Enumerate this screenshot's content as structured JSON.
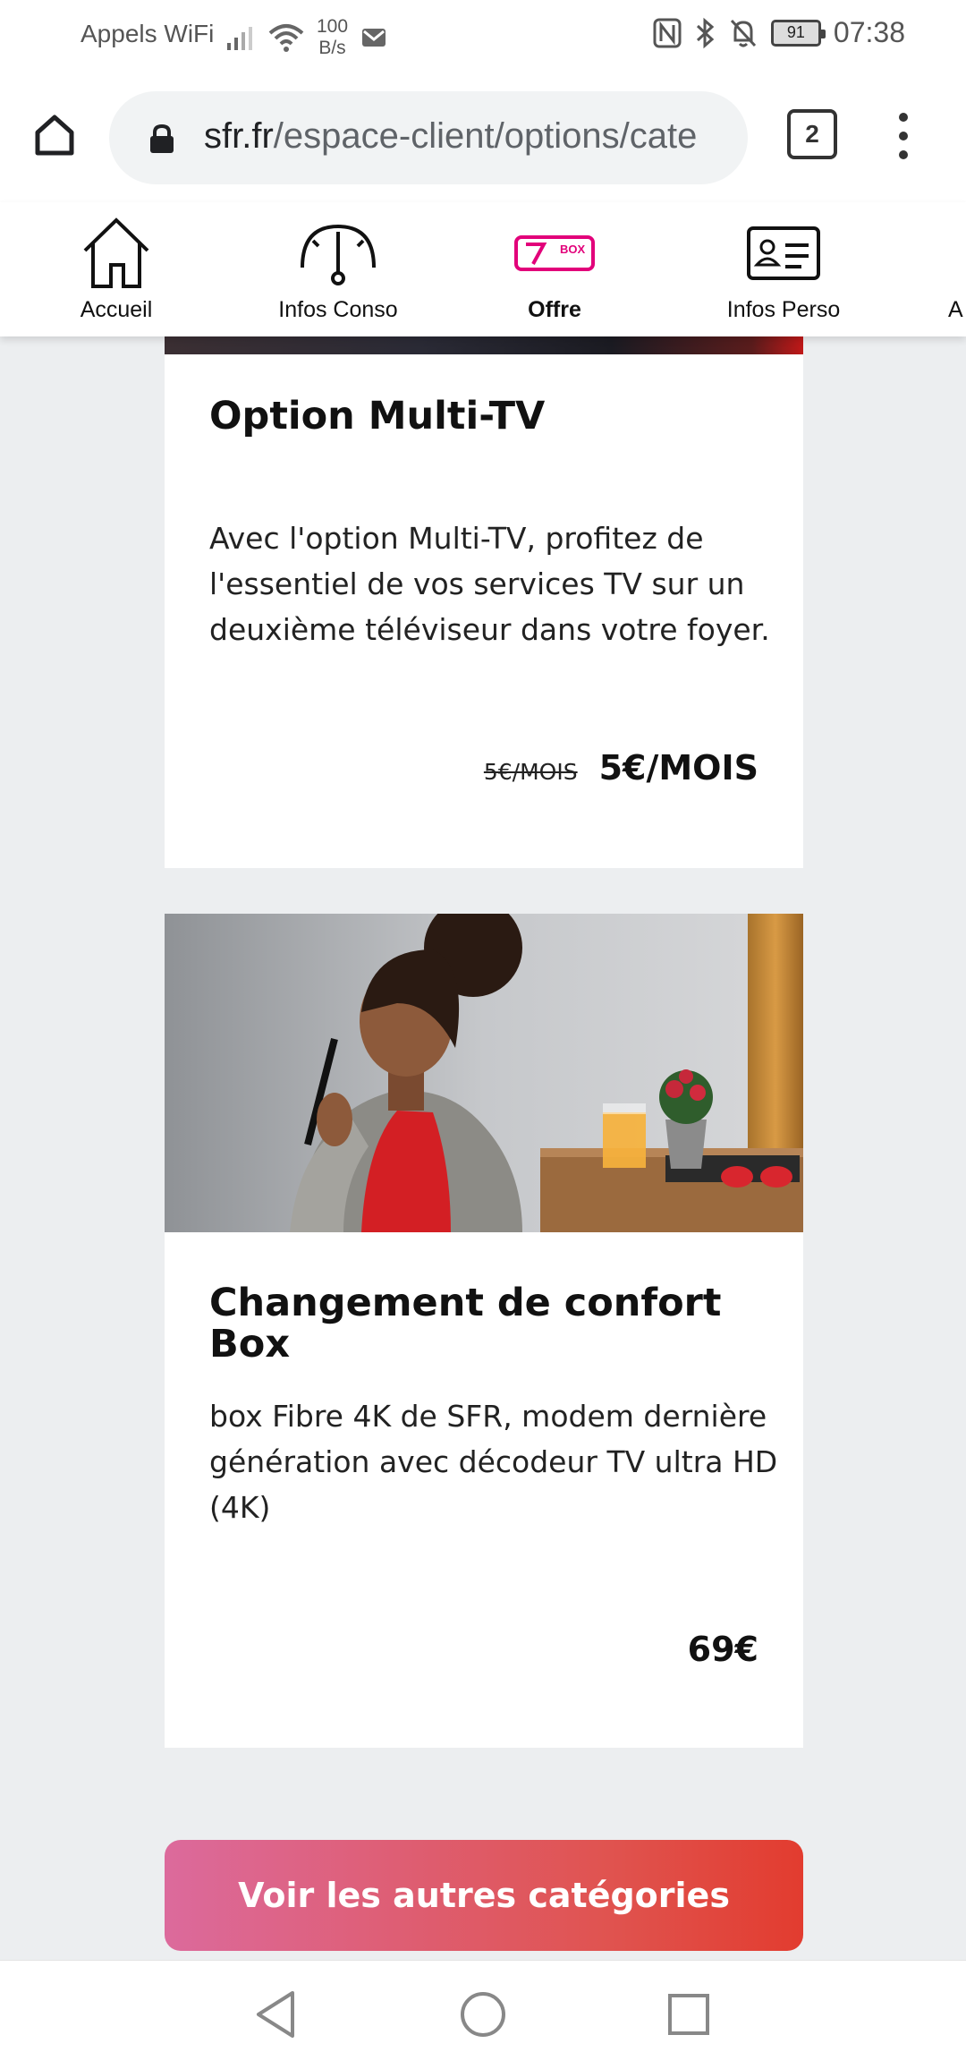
{
  "status_bar": {
    "carrier": "Appels WiFi",
    "speed_value": "100",
    "speed_unit": "B/s",
    "battery": "91",
    "time": "07:38"
  },
  "browser": {
    "url_domain": "sfr.fr",
    "url_path": "/espace-client/options/cate",
    "tab_count": "2"
  },
  "nav": {
    "items": [
      {
        "label": "Accueil",
        "icon": "home-icon"
      },
      {
        "label": "Infos Conso",
        "icon": "gauge-icon"
      },
      {
        "label": "Offre",
        "icon": "box-icon",
        "badge": "BOX",
        "active": true
      },
      {
        "label": "Infos Perso",
        "icon": "id-card-icon"
      },
      {
        "label": "A"
      }
    ]
  },
  "cards": [
    {
      "title": "Option Multi-TV",
      "description": "Avec l'option Multi-TV, profitez de l'essentiel de vos services TV sur un deuxième téléviseur dans votre foyer.",
      "old_price": "5€/MOIS",
      "price": "5€/MOIS"
    },
    {
      "title": "Changement de confort Box",
      "description": "box Fibre 4K de SFR, modem dernière génération avec décodeur TV ultra HD (4K)",
      "price": "69€"
    }
  ],
  "cta": {
    "label": "Voir les autres catégories"
  },
  "colors": {
    "accent": "#e2007a",
    "cta_start": "#dc6a9c",
    "cta_end": "#e23c2f"
  }
}
